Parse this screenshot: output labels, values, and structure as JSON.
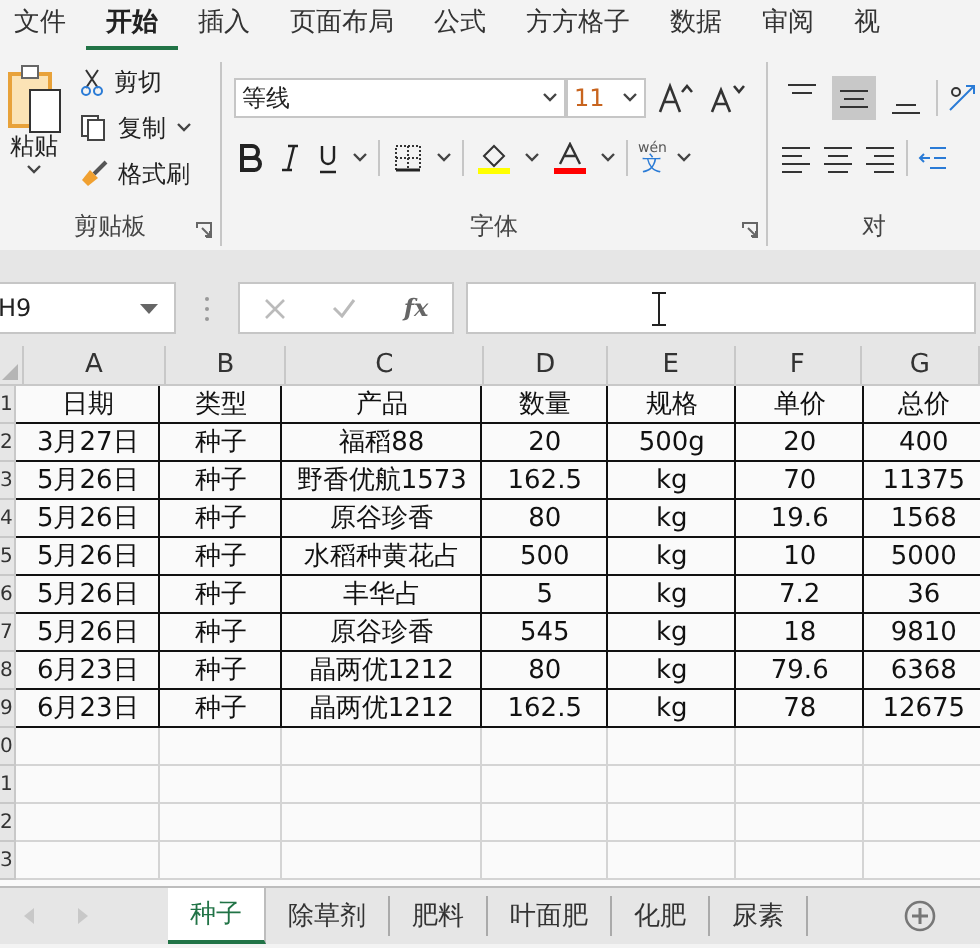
{
  "ribbon_tabs": [
    {
      "label": "文件",
      "selected": false
    },
    {
      "label": "开始",
      "selected": true
    },
    {
      "label": "插入",
      "selected": false
    },
    {
      "label": "页面布局",
      "selected": false
    },
    {
      "label": "公式",
      "selected": false
    },
    {
      "label": "方方格子",
      "selected": false
    },
    {
      "label": "数据",
      "selected": false
    },
    {
      "label": "审阅",
      "selected": false
    },
    {
      "label": "视",
      "selected": false
    }
  ],
  "clipboard": {
    "paste": "粘贴",
    "cut": "剪切",
    "copy": "复制",
    "format_painter": "格式刷",
    "label": "剪贴板"
  },
  "font": {
    "name": "等线",
    "size": "11",
    "phonetic": "wén",
    "phonetic_char": "文",
    "label": "字体"
  },
  "alignment": {
    "vertical": [
      {
        "kind": "top",
        "selected": false
      },
      {
        "kind": "middle",
        "selected": true
      },
      {
        "kind": "bottom",
        "selected": false
      }
    ],
    "label": "对"
  },
  "formula_bar": {
    "name_box": "H9",
    "fx": "fx"
  },
  "columns": [
    "A",
    "B",
    "C",
    "D",
    "E",
    "F",
    "G"
  ],
  "rows": [
    {
      "number": "1",
      "cells": [
        "日期",
        "类型",
        "产品",
        "数量",
        "规格",
        "单价",
        "总价"
      ]
    },
    {
      "number": "2",
      "cells": [
        "3月27日",
        "种子",
        "福稻88",
        "20",
        "500g",
        "20",
        "400"
      ]
    },
    {
      "number": "3",
      "cells": [
        "5月26日",
        "种子",
        "野香优航1573",
        "162.5",
        "kg",
        "70",
        "11375"
      ]
    },
    {
      "number": "4",
      "cells": [
        "5月26日",
        "种子",
        "原谷珍香",
        "80",
        "kg",
        "19.6",
        "1568"
      ]
    },
    {
      "number": "5",
      "cells": [
        "5月26日",
        "种子",
        "水稻种黄花占",
        "500",
        "kg",
        "10",
        "5000"
      ]
    },
    {
      "number": "6",
      "cells": [
        "5月26日",
        "种子",
        "丰华占",
        "5",
        "kg",
        "7.2",
        "36"
      ]
    },
    {
      "number": "7",
      "cells": [
        "5月26日",
        "种子",
        "原谷珍香",
        "545",
        "kg",
        "18",
        "9810"
      ]
    },
    {
      "number": "8",
      "cells": [
        "6月23日",
        "种子",
        "晶两优1212",
        "80",
        "kg",
        "79.6",
        "6368"
      ]
    },
    {
      "number": "9",
      "cells": [
        "6月23日",
        "种子",
        "晶两优1212",
        "162.5",
        "kg",
        "78",
        "12675"
      ]
    },
    {
      "number": "0",
      "cells": []
    },
    {
      "number": "1",
      "cells": []
    },
    {
      "number": "2",
      "cells": []
    },
    {
      "number": "3",
      "cells": []
    }
  ],
  "sheet_tabs": [
    {
      "label": "种子",
      "selected": true
    },
    {
      "label": "除草剂",
      "selected": false
    },
    {
      "label": "肥料",
      "selected": false
    },
    {
      "label": "叶面肥",
      "selected": false
    },
    {
      "label": "化肥",
      "selected": false
    },
    {
      "label": "尿素",
      "selected": false
    }
  ]
}
